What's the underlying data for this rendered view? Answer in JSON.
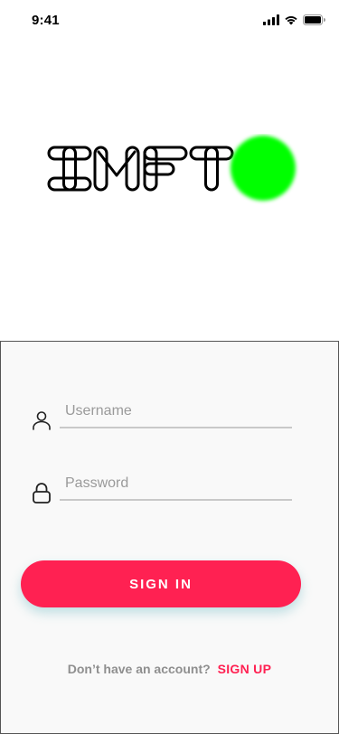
{
  "status_bar": {
    "time": "9:41",
    "icons": [
      "cellular-signal-icon",
      "wifi-icon",
      "battery-icon"
    ]
  },
  "logo": {
    "text": "IMFT",
    "dot_color": "#00ff00"
  },
  "login_form": {
    "username": {
      "icon": "user-icon",
      "placeholder": "Username",
      "value": ""
    },
    "password": {
      "icon": "lock-icon",
      "placeholder": "Password",
      "value": ""
    },
    "sign_in_label": "SIGN IN",
    "signup_prompt": "Don’t have an account?",
    "signup_label": "SIGN UP"
  },
  "colors": {
    "accent": "#ff2152",
    "panel_background": "#f9f9f9",
    "placeholder_text": "#9a9a9a",
    "logo_dot": "#00ff00"
  }
}
